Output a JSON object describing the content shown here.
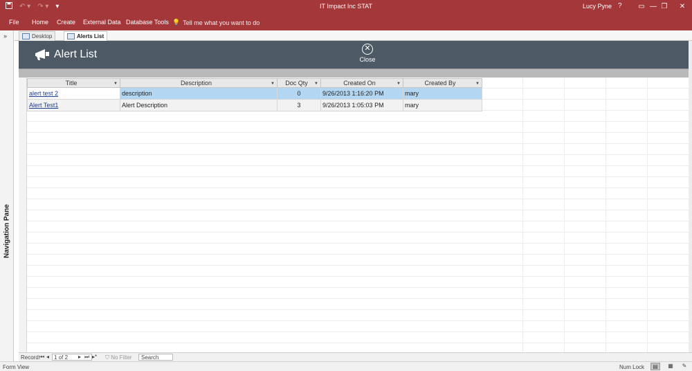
{
  "titlebar": {
    "title": "IT Impact Inc STAT",
    "user": "Lucy Pyne",
    "help": "?",
    "save_icon": "save-icon",
    "undo_icon": "undo-icon",
    "redo_icon": "redo-icon",
    "minimize": "—",
    "restore": "❐",
    "close": "✕"
  },
  "ribbon": {
    "tabs": [
      "File",
      "Home",
      "Create",
      "External Data",
      "Database Tools"
    ],
    "tell_me": "Tell me what you want to do"
  },
  "nav_pane": {
    "toggle": "»",
    "label": "Navigation Pane"
  },
  "doc_tabs": [
    {
      "label": "Desktop"
    },
    {
      "label": "Alerts List"
    }
  ],
  "doc_close": "✕",
  "form": {
    "title": "Alert List",
    "close_label": "Close"
  },
  "table": {
    "columns": [
      "Title",
      "Description",
      "Doc Qty",
      "Created On",
      "Created By"
    ],
    "rows": [
      {
        "title": "alert test 2",
        "description": "description",
        "doc_qty": "0",
        "created_on": "9/26/2013 1:16:20 PM",
        "created_by": "mary"
      },
      {
        "title": "Alert Test1",
        "description": "Alert Description",
        "doc_qty": "3",
        "created_on": "9/26/2013 1:05:03 PM",
        "created_by": "mary"
      }
    ]
  },
  "record_nav": {
    "label": "Record:",
    "current": "1 of 2",
    "no_filter": "No Filter",
    "search": "Search"
  },
  "status": {
    "left": "Form View",
    "num_lock": "Num Lock"
  },
  "colors": {
    "accent": "#a4373a",
    "header": "#4d5964",
    "selected_row": "#b3d7f3"
  }
}
